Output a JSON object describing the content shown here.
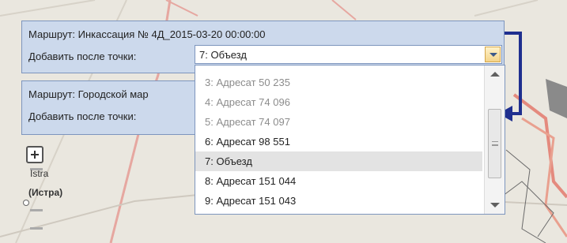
{
  "route_panel_top": {
    "route_label": "Маршрут: Инкассация № 4Д_2015-03-20 00:00:00",
    "add_after_label": "Добавить после точки:",
    "selected_point": "7: Объезд"
  },
  "route_panel_bottom": {
    "route_label": "Маршрут: Городской мар",
    "add_after_label": "Добавить после точки:"
  },
  "dropdown": {
    "items": [
      {
        "label": "3: Адресат 50 235"
      },
      {
        "label": "4: Адресат 74 096"
      },
      {
        "label": "5: Адресат 74 097"
      },
      {
        "label": "6: Адресат 98 551"
      },
      {
        "label": "7: Объезд"
      },
      {
        "label": "8: Адресат 151 044"
      },
      {
        "label": "9: Адресат 151 043"
      }
    ],
    "selected_index": 4
  },
  "map": {
    "place_istra_en": "Istra",
    "place_istra_ru": "(Истра)"
  },
  "colors": {
    "panel_bg": "#ccd9ec",
    "panel_border": "#7d95bd",
    "connector_arrow": "#1f2f8f"
  },
  "icons": {
    "zoom_in": "plus-icon",
    "dropdown_toggle": "chevron-down-icon",
    "connector": "bracket-arrow-icon"
  }
}
